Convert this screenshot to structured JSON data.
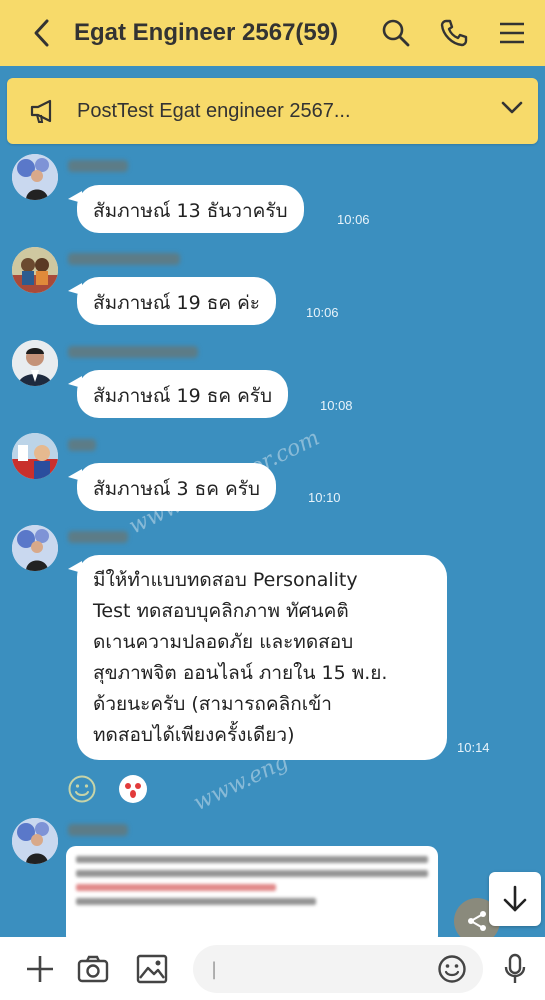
{
  "header": {
    "title": "Egat Engineer 2567(59)",
    "back_icon": "chevron-left-icon",
    "search_icon": "search-icon",
    "call_icon": "phone-icon",
    "menu_icon": "hamburger-menu-icon",
    "background": "#f7da6a"
  },
  "announcement": {
    "text": "PostTest Egat engineer 2567...",
    "icon": "megaphone-icon",
    "expand_icon": "chevron-down-icon"
  },
  "messages": [
    {
      "text": "สัมภาษณ์ 13 ธันวาครับ",
      "time": "10:06"
    },
    {
      "text": "สัมภาษณ์ 19 ธค ค่ะ",
      "time": "10:06"
    },
    {
      "text": "สัมภาษณ์ 19 ธค ครับ",
      "time": "10:08"
    },
    {
      "text": "สัมภาษณ์ 3 ธค ครับ",
      "time": "10:10"
    },
    {
      "lines": [
        "มีให้ทำแบบทดสอบ Personality",
        "Test ทดสอบบุคลิกภาพ ทัศนคติ",
        "ดเานความปลอดภัย และทดสอบ",
        "สุขภาพจิต ออนไลน์ ภายใน 15 พ.ย.",
        "ด้วยนะครับ (สามารถคลิกเข้า",
        "ทดสอบได้เพียงครั้งเดียว)"
      ],
      "time": "10:14"
    }
  ],
  "watermarks": [
    "www.engtutor.com",
    "www.eng"
  ],
  "footer": {
    "input_value": "|",
    "plus_icon": "plus-icon",
    "camera_icon": "camera-icon",
    "image_icon": "image-icon",
    "emoji_icon": "emoji-icon",
    "mic_icon": "microphone-icon"
  },
  "colors": {
    "chat_bg": "#3b8fbf",
    "bubble": "#ffffff",
    "time": "#e8f3fa"
  }
}
